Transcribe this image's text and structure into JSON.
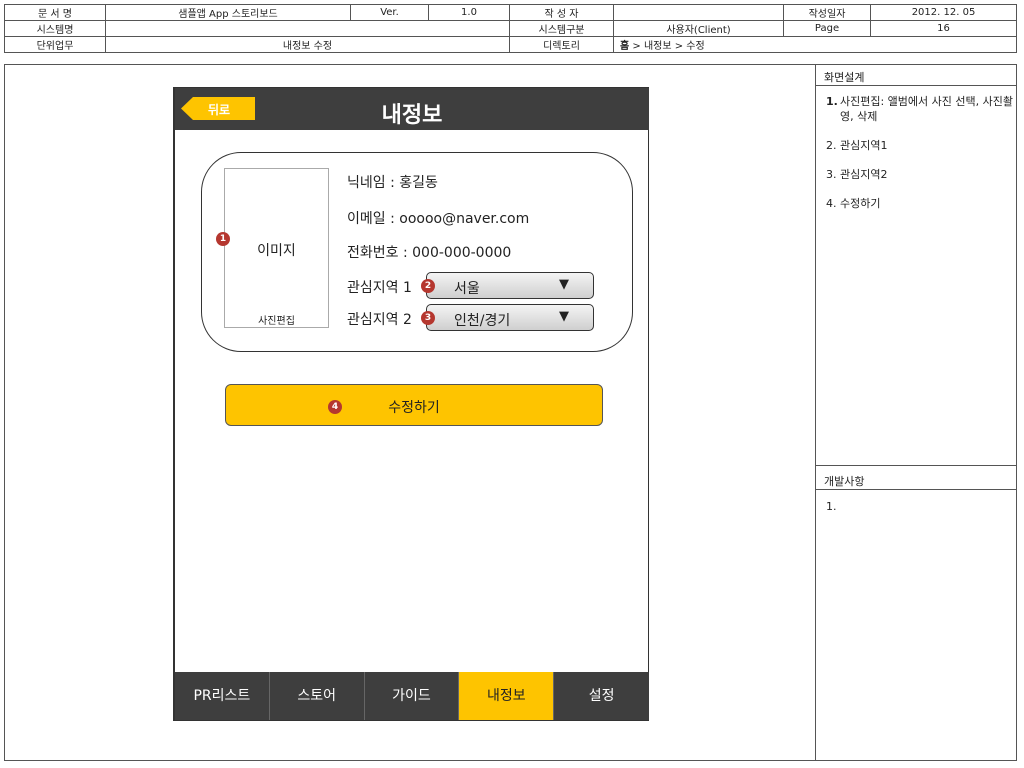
{
  "meta": {
    "doc_name_label": "문 서 명",
    "doc_name": "샘플앱 App 스토리보드",
    "ver_label": "Ver.",
    "ver": "1.0",
    "author_label": "작 성 자",
    "author": "",
    "date_label": "작성일자",
    "date": "2012. 12. 05",
    "system_label": "시스템명",
    "system": "",
    "sys_type_label": "시스템구분",
    "sys_type": "사용자(Client)",
    "page_label": "Page",
    "page": "16",
    "unit_label": "단위업무",
    "unit": "내정보 수정",
    "dir_label": "디렉토리",
    "dir_home": "홈",
    "dir_rest": " > 내정보 > 수정"
  },
  "screen": {
    "back_label": "뒤로",
    "title": "내정보",
    "image_label": "이미지",
    "photo_edit_label": "사진편집",
    "nickname": "닉네임 : 홍길동",
    "email": "이메일 : ooooo@naver.com",
    "phone": "전화번호 : 000-000-0000",
    "region1_label": "관심지역 1",
    "region1_value": "서울",
    "region2_label": "관심지역 2",
    "region2_value": "인천/경기",
    "dropdown_arrow": "▼",
    "submit_label": "수정하기",
    "tabs": [
      "PR리스트",
      "스토어",
      "가이드",
      "내정보",
      "설정"
    ],
    "active_tab": "내정보",
    "colors": {
      "accent": "#fec400",
      "bar": "#3e3e3e",
      "badge": "#b5372f"
    }
  },
  "badges": [
    "1",
    "2",
    "3",
    "4"
  ],
  "panel": {
    "design_title": "화면설계",
    "items": [
      {
        "num": "1.",
        "text": "사진편집: 앨범에서 사진 선택, 사진촬영, 삭제"
      },
      {
        "num": "2.",
        "text": "관심지역1"
      },
      {
        "num": "3.",
        "text": "관심지역2"
      },
      {
        "num": "4.",
        "text": "수정하기"
      }
    ],
    "dev_title": "개발사항",
    "dev_items": [
      "1."
    ]
  }
}
